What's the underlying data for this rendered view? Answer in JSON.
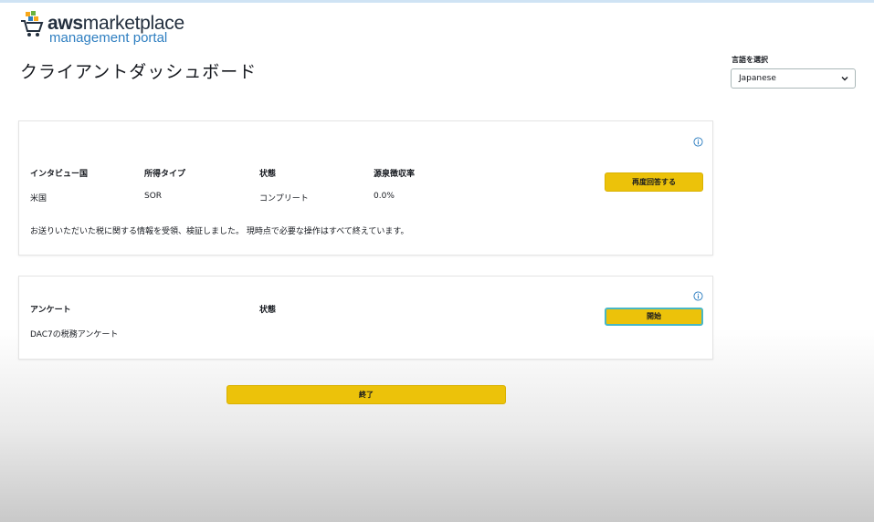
{
  "logo": {
    "brand_bold": "aws",
    "brand_rest": "marketplace",
    "subtitle": "management portal"
  },
  "page_title": "クライアントダッシュボード",
  "language": {
    "label": "言語を選択",
    "selected": "Japanese"
  },
  "tax_card": {
    "headers": [
      "インタビュー国",
      "所得タイプ",
      "状態",
      "源泉徴収率"
    ],
    "values": [
      "米国",
      "SOR",
      "コンプリート",
      "0.0%"
    ],
    "message": "お送りいただいた税に関する情報を受領、検証しました。 現時点で必要な操作はすべて終えています。",
    "button": "再度回答する"
  },
  "survey_card": {
    "headers": [
      "アンケート",
      "状態"
    ],
    "values": [
      "DAC7の税務アンケート",
      ""
    ],
    "button": "開始"
  },
  "finish_button": "終了",
  "colors": {
    "button": "#ecc20a",
    "link_blue": "#2f7fc1",
    "focus_ring": "#49b7c4"
  }
}
